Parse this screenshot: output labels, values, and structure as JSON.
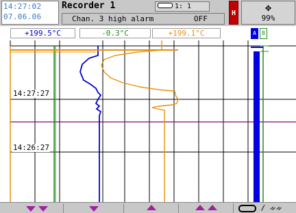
{
  "header": {
    "time": "14:27:02",
    "date": "07.06.06",
    "title": "Recorder 1",
    "channel_label": "1: 1",
    "alarm_message": "Chan. 3 high alarm",
    "alarm_state": "OFF",
    "hold_label": "H",
    "memory_percent": "99%",
    "memory_icon": "compass-icon"
  },
  "values": {
    "ch1": "+199.5°C",
    "ch2": "-0.3°C",
    "ch3": "+199.1°C"
  },
  "bar_labels": {
    "b1": "A",
    "b2": "B"
  },
  "chart": {
    "time_labels": [
      "14:27:27",
      "14:26:27"
    ],
    "colors": {
      "ch1": "#0000d0",
      "ch2": "#1e8c1e",
      "ch3": "#e8900a",
      "marker": "#800080",
      "bar": "#0000e0"
    },
    "bar_level": 1.0
  },
  "footer": {
    "buttons": [
      "scroll-down-fast",
      "scroll-down",
      "scroll-up",
      "scroll-up-fast"
    ],
    "search_icon": "binoculars-icon",
    "toggle_icon": "toggle-icon"
  }
}
